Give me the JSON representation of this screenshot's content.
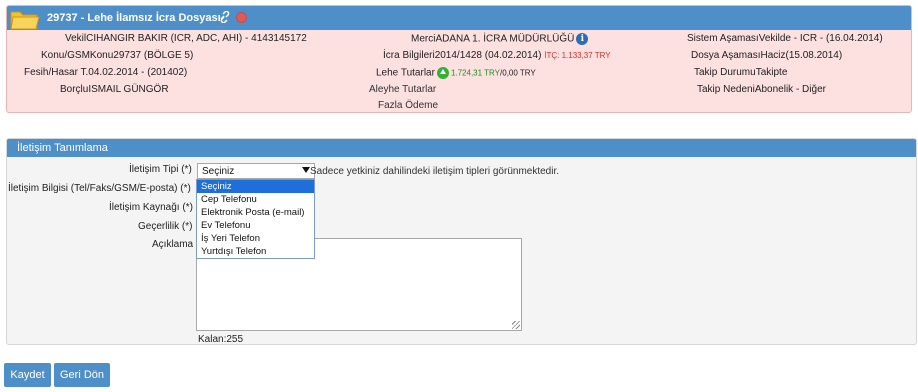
{
  "case": {
    "title": "29737 - Lehe İlamsız İcra Dosyası",
    "vekil_label": "Vekil",
    "vekil_value": "CIHANGIR BAKIR (ICR, ADC, AHI) - 4143145172",
    "konu_label": "Konu/GSM",
    "konu_value": "Konu29737 (BÖLGE 5)",
    "fesih_label": "Fesih/Hasar T.",
    "fesih_value": "04.02.2014 - (201402)",
    "borclu_label": "Borçlu",
    "borclu_value": "ISMAIL GÜNGÖR",
    "merci_label": "Merci",
    "merci_value": "ADANA 1. İCRA MÜDÜRLÜĞÜ",
    "icra_label": "İcra Bilgileri",
    "icra_value": "2014/1428 (04.02.2014)",
    "itc_value": "İTÇ: 1.133,37 TRY",
    "lehe_label": "Lehe Tutarlar",
    "lehe_value": "1.724,31 TRY",
    "lehe_extra": "/0,00 TRY",
    "aleyhe_label": "Aleyhe Tutarlar",
    "fazla_label": "Fazla Ödeme",
    "sistem_label": "Sistem Aşaması",
    "sistem_value": "Vekilde - ICR - (16.04.2014)",
    "dosya_label": "Dosya Aşaması",
    "dosya_value": "Haciz(15.08.2014)",
    "takip_label": "Takip Durumu",
    "takip_value": "Takipte",
    "neden_label": "Takip Nedeni",
    "neden_value": "Abonelik - Diğer"
  },
  "form": {
    "title": "İletişim Tanımlama",
    "tip_label": "İletişim Tipi (*)",
    "tip_selected": "Seçiniz",
    "tip_hint": "Sadece yetkiniz dahilindeki iletişim tipleri görünmektedir.",
    "bilgi_label": "İletişim Bilgisi (Tel/Faks/GSM/E-posta) (*)",
    "kaynak_label": "İletişim Kaynağı (*)",
    "gecerlilik_label": "Geçerlilik (*)",
    "aciklama_label": "Açıklama",
    "kalan": "Kalan:255",
    "options": [
      "Seçiniz",
      "Cep Telefonu",
      "Elektronik Posta (e-mail)",
      "Ev Telefonu",
      "İş Yeri Telefon",
      "Yurtdışı Telefon"
    ]
  },
  "buttons": {
    "save": "Kaydet",
    "back": "Geri Dön"
  },
  "colors": {
    "header_blue": "#4f8fc9",
    "case_bg": "#fde0e0",
    "selected_blue": "#1e6fd9"
  }
}
